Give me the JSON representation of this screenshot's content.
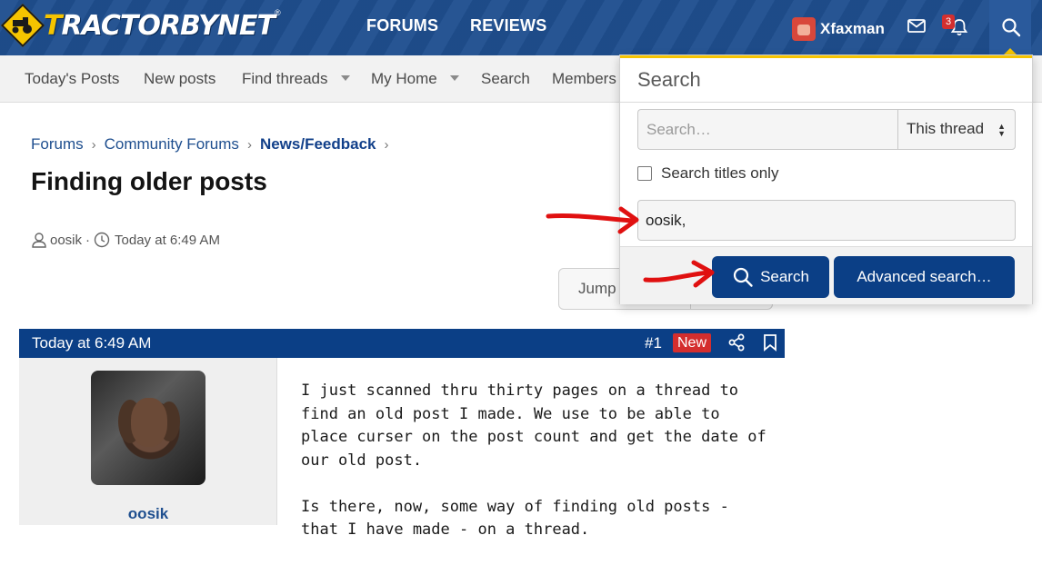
{
  "header": {
    "logo_prefix": "T",
    "logo_rest": "RACTORBYNET",
    "logo_reg": "®",
    "nav": [
      "FORUMS",
      "REVIEWS"
    ],
    "username": "Xfaxman",
    "notification_count": "3"
  },
  "subnav": {
    "items": [
      "Today's Posts",
      "New posts",
      "Find threads",
      "My Home",
      "Search",
      "Members"
    ]
  },
  "breadcrumb": [
    "Forums",
    "Community Forums",
    "News/Feedback"
  ],
  "thread": {
    "title": "Finding older posts",
    "author": "oosik",
    "date": "Today at 6:49 AM"
  },
  "jump_label": "Jump",
  "post": {
    "time": "Today at 6:49 AM",
    "number": "#1",
    "new_label": "New",
    "author": "oosik",
    "paragraphs": [
      "I just scanned thru thirty pages on a thread to find an old post I made. We use to be able to place curser on the post count and get the date of our old post.",
      "Is there, now, some way of finding old posts - that I have made - on a thread."
    ]
  },
  "search_menu": {
    "title": "Search",
    "placeholder": "Search…",
    "scope": "This thread",
    "titles_only_label": "Search titles only",
    "member_value": "oosik,",
    "search_button": "Search",
    "advanced_button": "Advanced search…"
  },
  "colors": {
    "header_blue": "#1f4f8f",
    "brand_yellow": "#f5c400",
    "button_blue": "#0b3f86",
    "badge_red": "#d42e2e",
    "annotation_red": "#e01010"
  }
}
